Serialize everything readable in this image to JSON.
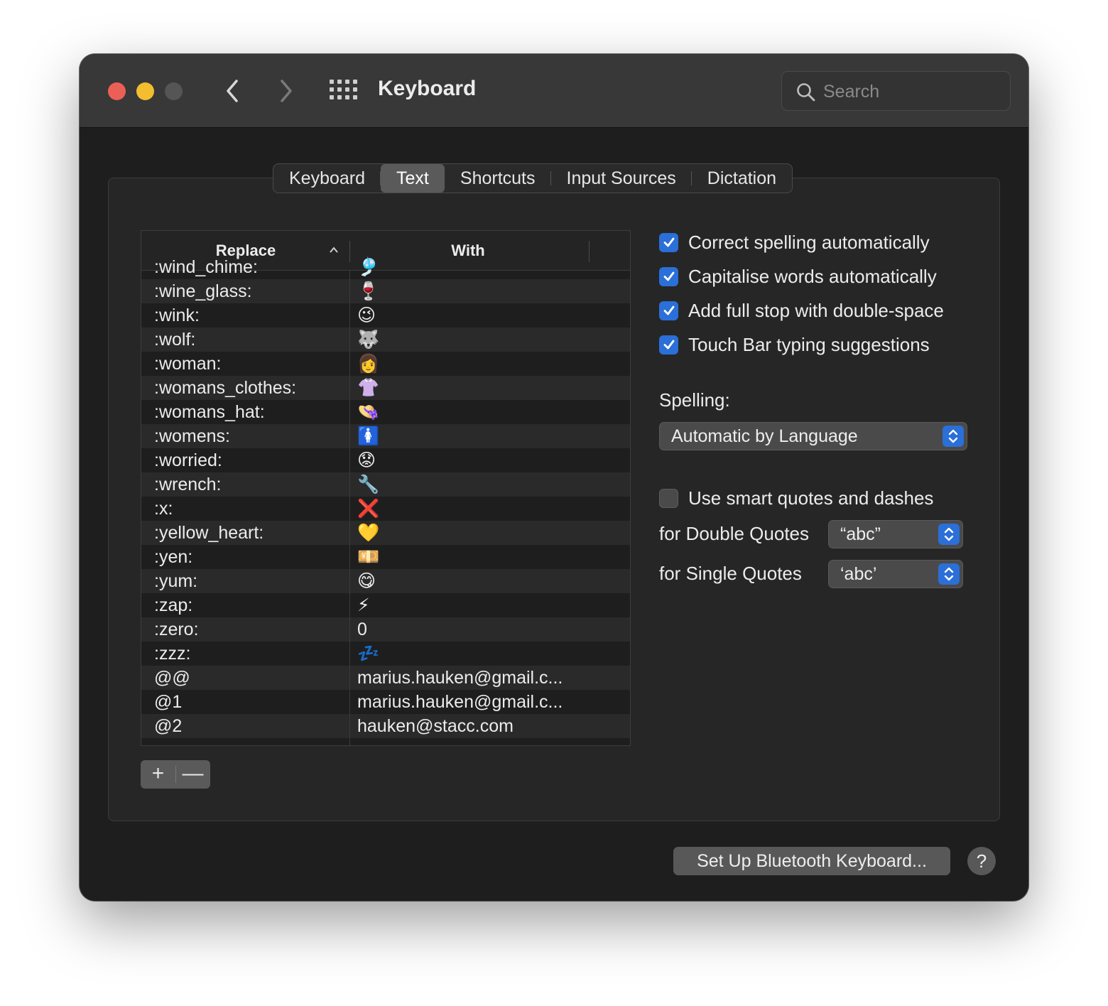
{
  "window": {
    "title": "Keyboard"
  },
  "search": {
    "placeholder": "Search"
  },
  "tabs": [
    {
      "label": "Keyboard",
      "active": false
    },
    {
      "label": "Text",
      "active": true
    },
    {
      "label": "Shortcuts",
      "active": false
    },
    {
      "label": "Input Sources",
      "active": false
    },
    {
      "label": "Dictation",
      "active": false
    }
  ],
  "table": {
    "headers": {
      "replace": "Replace",
      "with": "With"
    },
    "rows": [
      {
        "replace": ":wind_chime:",
        "with": "🎐"
      },
      {
        "replace": ":wine_glass:",
        "with": "🍷"
      },
      {
        "replace": ":wink:",
        "with": "😉"
      },
      {
        "replace": ":wolf:",
        "with": "🐺"
      },
      {
        "replace": ":woman:",
        "with": "👩"
      },
      {
        "replace": ":womans_clothes:",
        "with": "👚"
      },
      {
        "replace": ":womans_hat:",
        "with": "👒"
      },
      {
        "replace": ":womens:",
        "with": "🚺"
      },
      {
        "replace": ":worried:",
        "with": "😟"
      },
      {
        "replace": ":wrench:",
        "with": "🔧"
      },
      {
        "replace": ":x:",
        "with": "❌"
      },
      {
        "replace": ":yellow_heart:",
        "with": "💛"
      },
      {
        "replace": ":yen:",
        "with": "💴"
      },
      {
        "replace": ":yum:",
        "with": "😋"
      },
      {
        "replace": ":zap:",
        "with": "⚡"
      },
      {
        "replace": ":zero:",
        "with": "0"
      },
      {
        "replace": ":zzz:",
        "with": "💤"
      },
      {
        "replace": "@@",
        "with": "marius.hauken@gmail.c..."
      },
      {
        "replace": "@1",
        "with": "marius.hauken@gmail.c..."
      },
      {
        "replace": "@2",
        "with": "hauken@stacc.com"
      }
    ]
  },
  "buttons": {
    "add": "+",
    "remove": "—"
  },
  "options": [
    {
      "label": "Correct spelling automatically",
      "checked": true
    },
    {
      "label": "Capitalise words automatically",
      "checked": true
    },
    {
      "label": "Add full stop with double-space",
      "checked": true
    },
    {
      "label": "Touch Bar typing suggestions",
      "checked": true
    }
  ],
  "spelling": {
    "label": "Spelling:",
    "value": "Automatic by Language"
  },
  "smart_quotes": {
    "label": "Use smart quotes and dashes",
    "checked": false
  },
  "double_quotes": {
    "label": "for Double Quotes",
    "value": "“abc”"
  },
  "single_quotes": {
    "label": "for Single Quotes",
    "value": "‘abc’"
  },
  "bluetooth_button": "Set Up Bluetooth Keyboard...",
  "help_button": "?",
  "colors": {
    "accent": "#2b6fd8",
    "close": "#ec5f57",
    "minimize": "#f3bd2f",
    "zoom_disabled": "#555555"
  }
}
